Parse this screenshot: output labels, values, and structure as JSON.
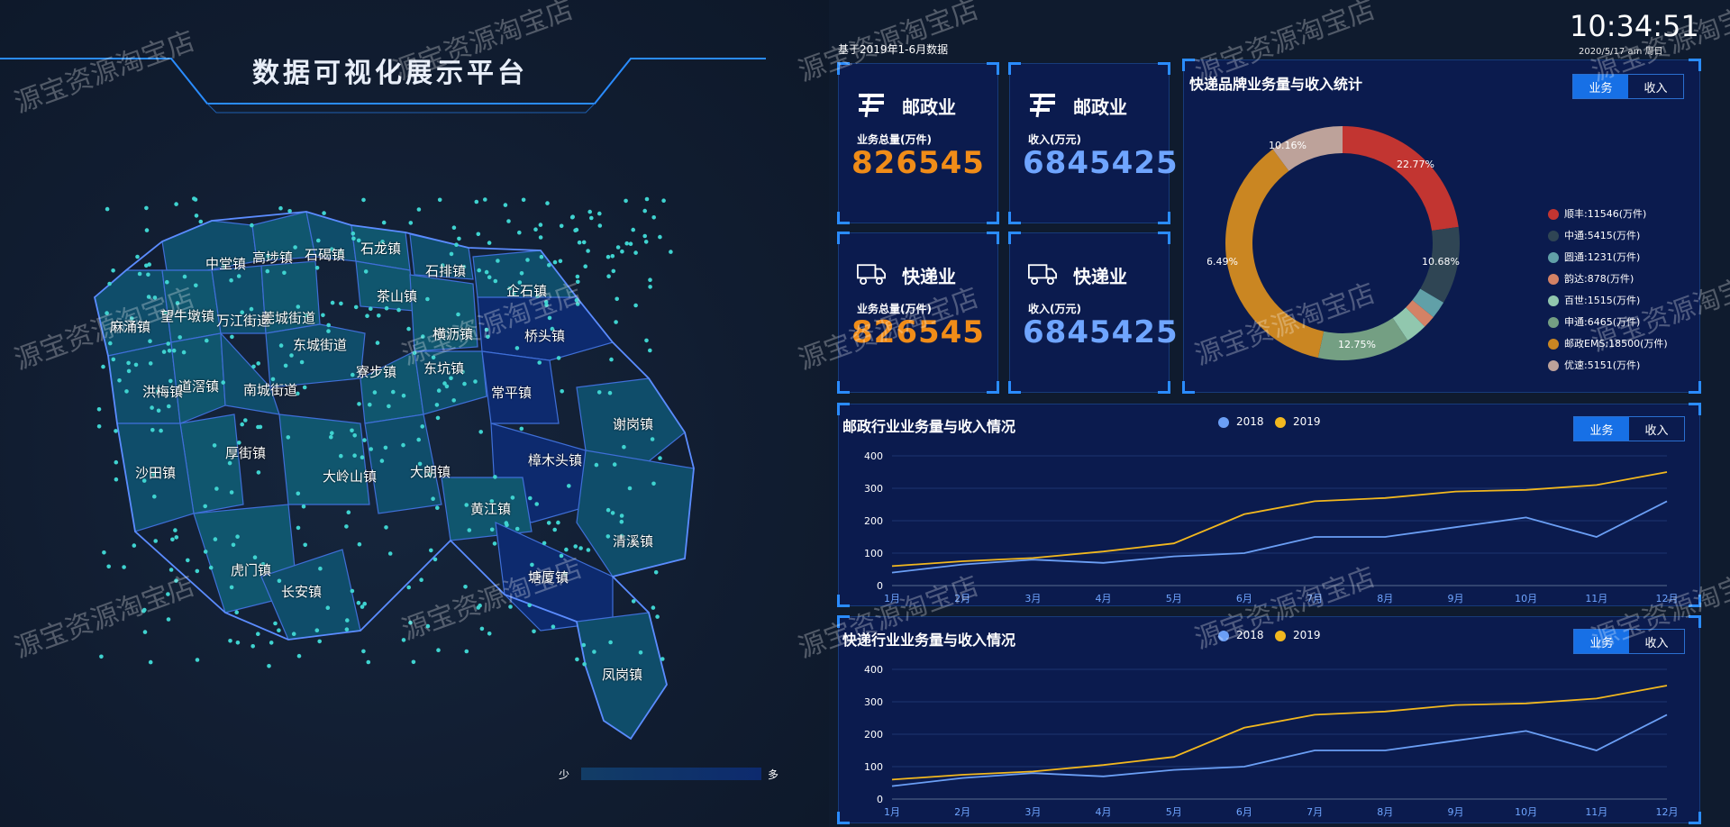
{
  "title": "数据可视化展示平台",
  "clock": {
    "time": "10:34:51",
    "date": "2020/5/17  am  周日"
  },
  "data_note": "基于2019年1-6月数据",
  "kpis": [
    {
      "icon": "china-post-icon",
      "title": "邮政业",
      "sub": "业务总量(万件)",
      "value": "826545",
      "color": "orange"
    },
    {
      "icon": "china-post-icon",
      "title": "邮政业",
      "sub": "收入(万元)",
      "value": "6845425",
      "color": "blue"
    },
    {
      "icon": "delivery-truck-icon",
      "title": "快递业",
      "sub": "业务总量(万件)",
      "value": "826545",
      "color": "orange"
    },
    {
      "icon": "delivery-truck-icon",
      "title": "快递业",
      "sub": "收入(万元)",
      "value": "6845425",
      "color": "blue"
    }
  ],
  "donut": {
    "title": "快递品牌业务量与收入统计",
    "toggle": [
      "业务",
      "收入"
    ],
    "items": [
      {
        "label": "顺丰:11546(万件)",
        "value": 11546,
        "color": "#c23531"
      },
      {
        "label": "中通:5415(万件)",
        "value": 5415,
        "color": "#2f4554"
      },
      {
        "label": "圆通:1231(万件)",
        "value": 1231,
        "color": "#61a0a8"
      },
      {
        "label": "韵达:878(万件)",
        "value": 878,
        "color": "#d48265"
      },
      {
        "label": "百世:1515(万件)",
        "value": 1515,
        "color": "#91c7ae"
      },
      {
        "label": "申通:6465(万件)",
        "value": 6465,
        "color": "#749f83"
      },
      {
        "label": "邮政EMS:18500(万件)",
        "value": 18500,
        "color": "#ca8622"
      },
      {
        "label": "优速:5151(万件)",
        "value": 5151,
        "color": "#bda29a"
      }
    ],
    "pct_labels": [
      "22.77%",
      "10.68%",
      "12.75%",
      "36.49%",
      "10.16%"
    ]
  },
  "postal_chart": {
    "title": "邮政行业业务量与收入情况",
    "toggle": [
      "业务",
      "收入"
    ],
    "legend": [
      "2018",
      "2019"
    ]
  },
  "express_chart": {
    "title": "快递行业业务量与收入情况",
    "toggle": [
      "业务",
      "收入"
    ],
    "legend": [
      "2018",
      "2019"
    ]
  },
  "chart_data": [
    {
      "type": "pie",
      "title": "快递品牌业务量与收入统计",
      "categories": [
        "顺丰",
        "中通",
        "圆通",
        "韵达",
        "百世",
        "申通",
        "邮政EMS",
        "优速"
      ],
      "values": [
        11546,
        5415,
        1231,
        878,
        1515,
        6465,
        18500,
        5151
      ]
    },
    {
      "type": "line",
      "title": "邮政行业业务量与收入情况",
      "categories": [
        "1月",
        "2月",
        "3月",
        "4月",
        "5月",
        "6月",
        "7月",
        "8月",
        "9月",
        "10月",
        "11月",
        "12月"
      ],
      "ylim": [
        0,
        400
      ],
      "yticks": [
        0,
        100,
        200,
        300,
        400
      ],
      "series": [
        {
          "name": "2018",
          "color": "#6b9ff5",
          "values": [
            40,
            65,
            80,
            70,
            90,
            100,
            150,
            150,
            180,
            210,
            150,
            260
          ]
        },
        {
          "name": "2019",
          "color": "#f2b81f",
          "values": [
            60,
            75,
            85,
            105,
            130,
            220,
            260,
            270,
            290,
            295,
            310,
            350
          ]
        }
      ]
    },
    {
      "type": "line",
      "title": "快递行业业务量与收入情况",
      "categories": [
        "1月",
        "2月",
        "3月",
        "4月",
        "5月",
        "6月",
        "7月",
        "8月",
        "9月",
        "10月",
        "11月",
        "12月"
      ],
      "ylim": [
        0,
        400
      ],
      "yticks": [
        0,
        100,
        200,
        300,
        400
      ],
      "series": [
        {
          "name": "2018",
          "color": "#6b9ff5",
          "values": [
            40,
            65,
            80,
            70,
            90,
            100,
            150,
            150,
            180,
            210,
            150,
            260
          ]
        },
        {
          "name": "2019",
          "color": "#f2b81f",
          "values": [
            60,
            75,
            85,
            105,
            130,
            220,
            260,
            270,
            290,
            295,
            310,
            350
          ]
        }
      ]
    }
  ],
  "map": {
    "towns": [
      "中堂镇",
      "高埗镇",
      "石碣镇",
      "石龙镇",
      "石排镇",
      "茶山镇",
      "企石镇",
      "麻涌镇",
      "望牛墩镇",
      "万江街道",
      "莞城街道",
      "东城街道",
      "横沥镇",
      "桥头镇",
      "洪梅镇",
      "道滘镇",
      "南城街道",
      "寮步镇",
      "东坑镇",
      "常平镇",
      "谢岗镇",
      "厚街镇",
      "沙田镇",
      "大岭山镇",
      "大朗镇",
      "樟木头镇",
      "黄江镇",
      "清溪镇",
      "虎门镇",
      "长安镇",
      "塘厦镇",
      "凤岗镇"
    ],
    "legend_low": "少",
    "legend_high": "多"
  },
  "watermark": "源宝资源淘宝店"
}
